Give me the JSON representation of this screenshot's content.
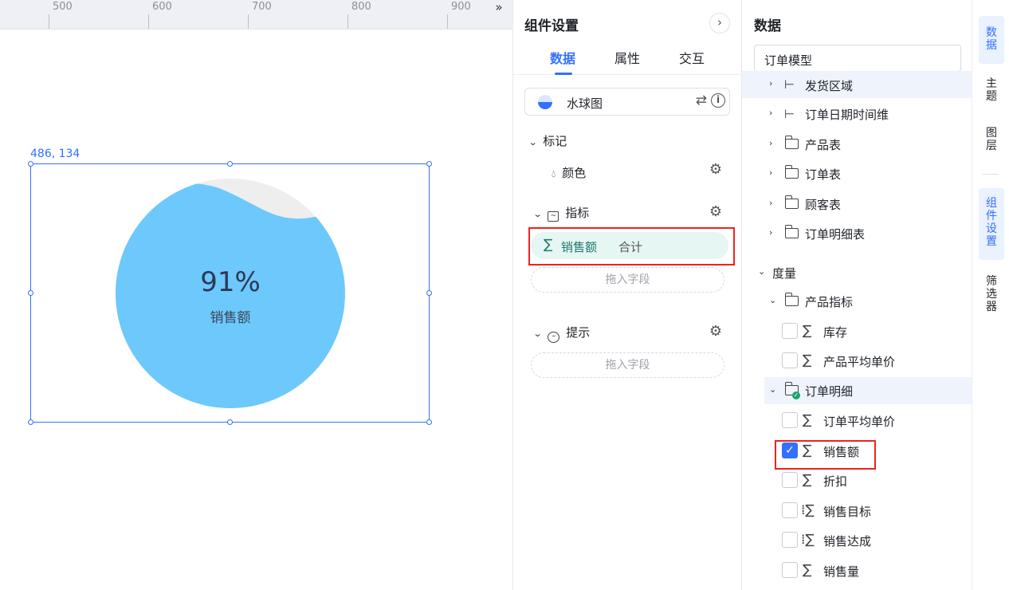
{
  "ruler": {
    "labels": [
      "500",
      "600",
      "700",
      "800",
      "900"
    ],
    "collapse_icon": "double-chevron-right-icon"
  },
  "canvas": {
    "position_label": "486, 134"
  },
  "widget": {
    "value": "91%",
    "name": "销售额"
  },
  "settings": {
    "title": "组件设置",
    "close_icon": "chevron-right-icon",
    "tabs": [
      {
        "label": "数据"
      },
      {
        "label": "属性"
      },
      {
        "label": "交互"
      }
    ],
    "chart_type": {
      "label": "水球图",
      "icon": "liquid-ball-icon",
      "swap_icon": "swap-icon",
      "info_icon": "info-icon"
    },
    "mark": {
      "label": "标记",
      "color_label": "颜色"
    },
    "indicator": {
      "label": "指标",
      "field": "销售额",
      "agg": "合计",
      "drop_placeholder": "拖入字段"
    },
    "tooltip": {
      "label": "提示",
      "drop_placeholder": "拖入字段"
    }
  },
  "data": {
    "title": "数据",
    "model": "订单模型",
    "dimensions": [
      {
        "label": "发货区域",
        "icon": "hierarchy-icon"
      },
      {
        "label": "订单日期时间维",
        "icon": "hierarchy-icon"
      },
      {
        "label": "产品表",
        "icon": "folder-icon"
      },
      {
        "label": "订单表",
        "icon": "folder-icon"
      },
      {
        "label": "顾客表",
        "icon": "folder-icon"
      },
      {
        "label": "订单明细表",
        "icon": "folder-icon"
      }
    ],
    "measure_label": "度量",
    "groups": [
      {
        "label": "产品指标",
        "items": [
          {
            "label": "库存",
            "checked": false
          },
          {
            "label": "产品平均单价",
            "checked": false
          }
        ]
      },
      {
        "label": "订单明细",
        "items": [
          {
            "label": "订单平均单价",
            "checked": false
          },
          {
            "label": "销售额",
            "checked": true
          },
          {
            "label": "折扣",
            "checked": false
          },
          {
            "label": "销售目标",
            "checked": false
          },
          {
            "label": "销售达成",
            "checked": false
          },
          {
            "label": "销售量",
            "checked": false
          }
        ]
      }
    ]
  },
  "sidebar": {
    "items": [
      {
        "label": "数据",
        "active": true
      },
      {
        "label": "主题",
        "active": false
      },
      {
        "label": "图层",
        "active": false
      },
      {
        "label": "组件设置",
        "active": true
      },
      {
        "label": "筛选器",
        "active": false
      }
    ]
  },
  "colors": {
    "accent": "#3370ff",
    "ball": "#6dc8fc",
    "ball_bg": "#eeeeee",
    "highlight": "#e22222",
    "pill": "#e6f6f3"
  }
}
